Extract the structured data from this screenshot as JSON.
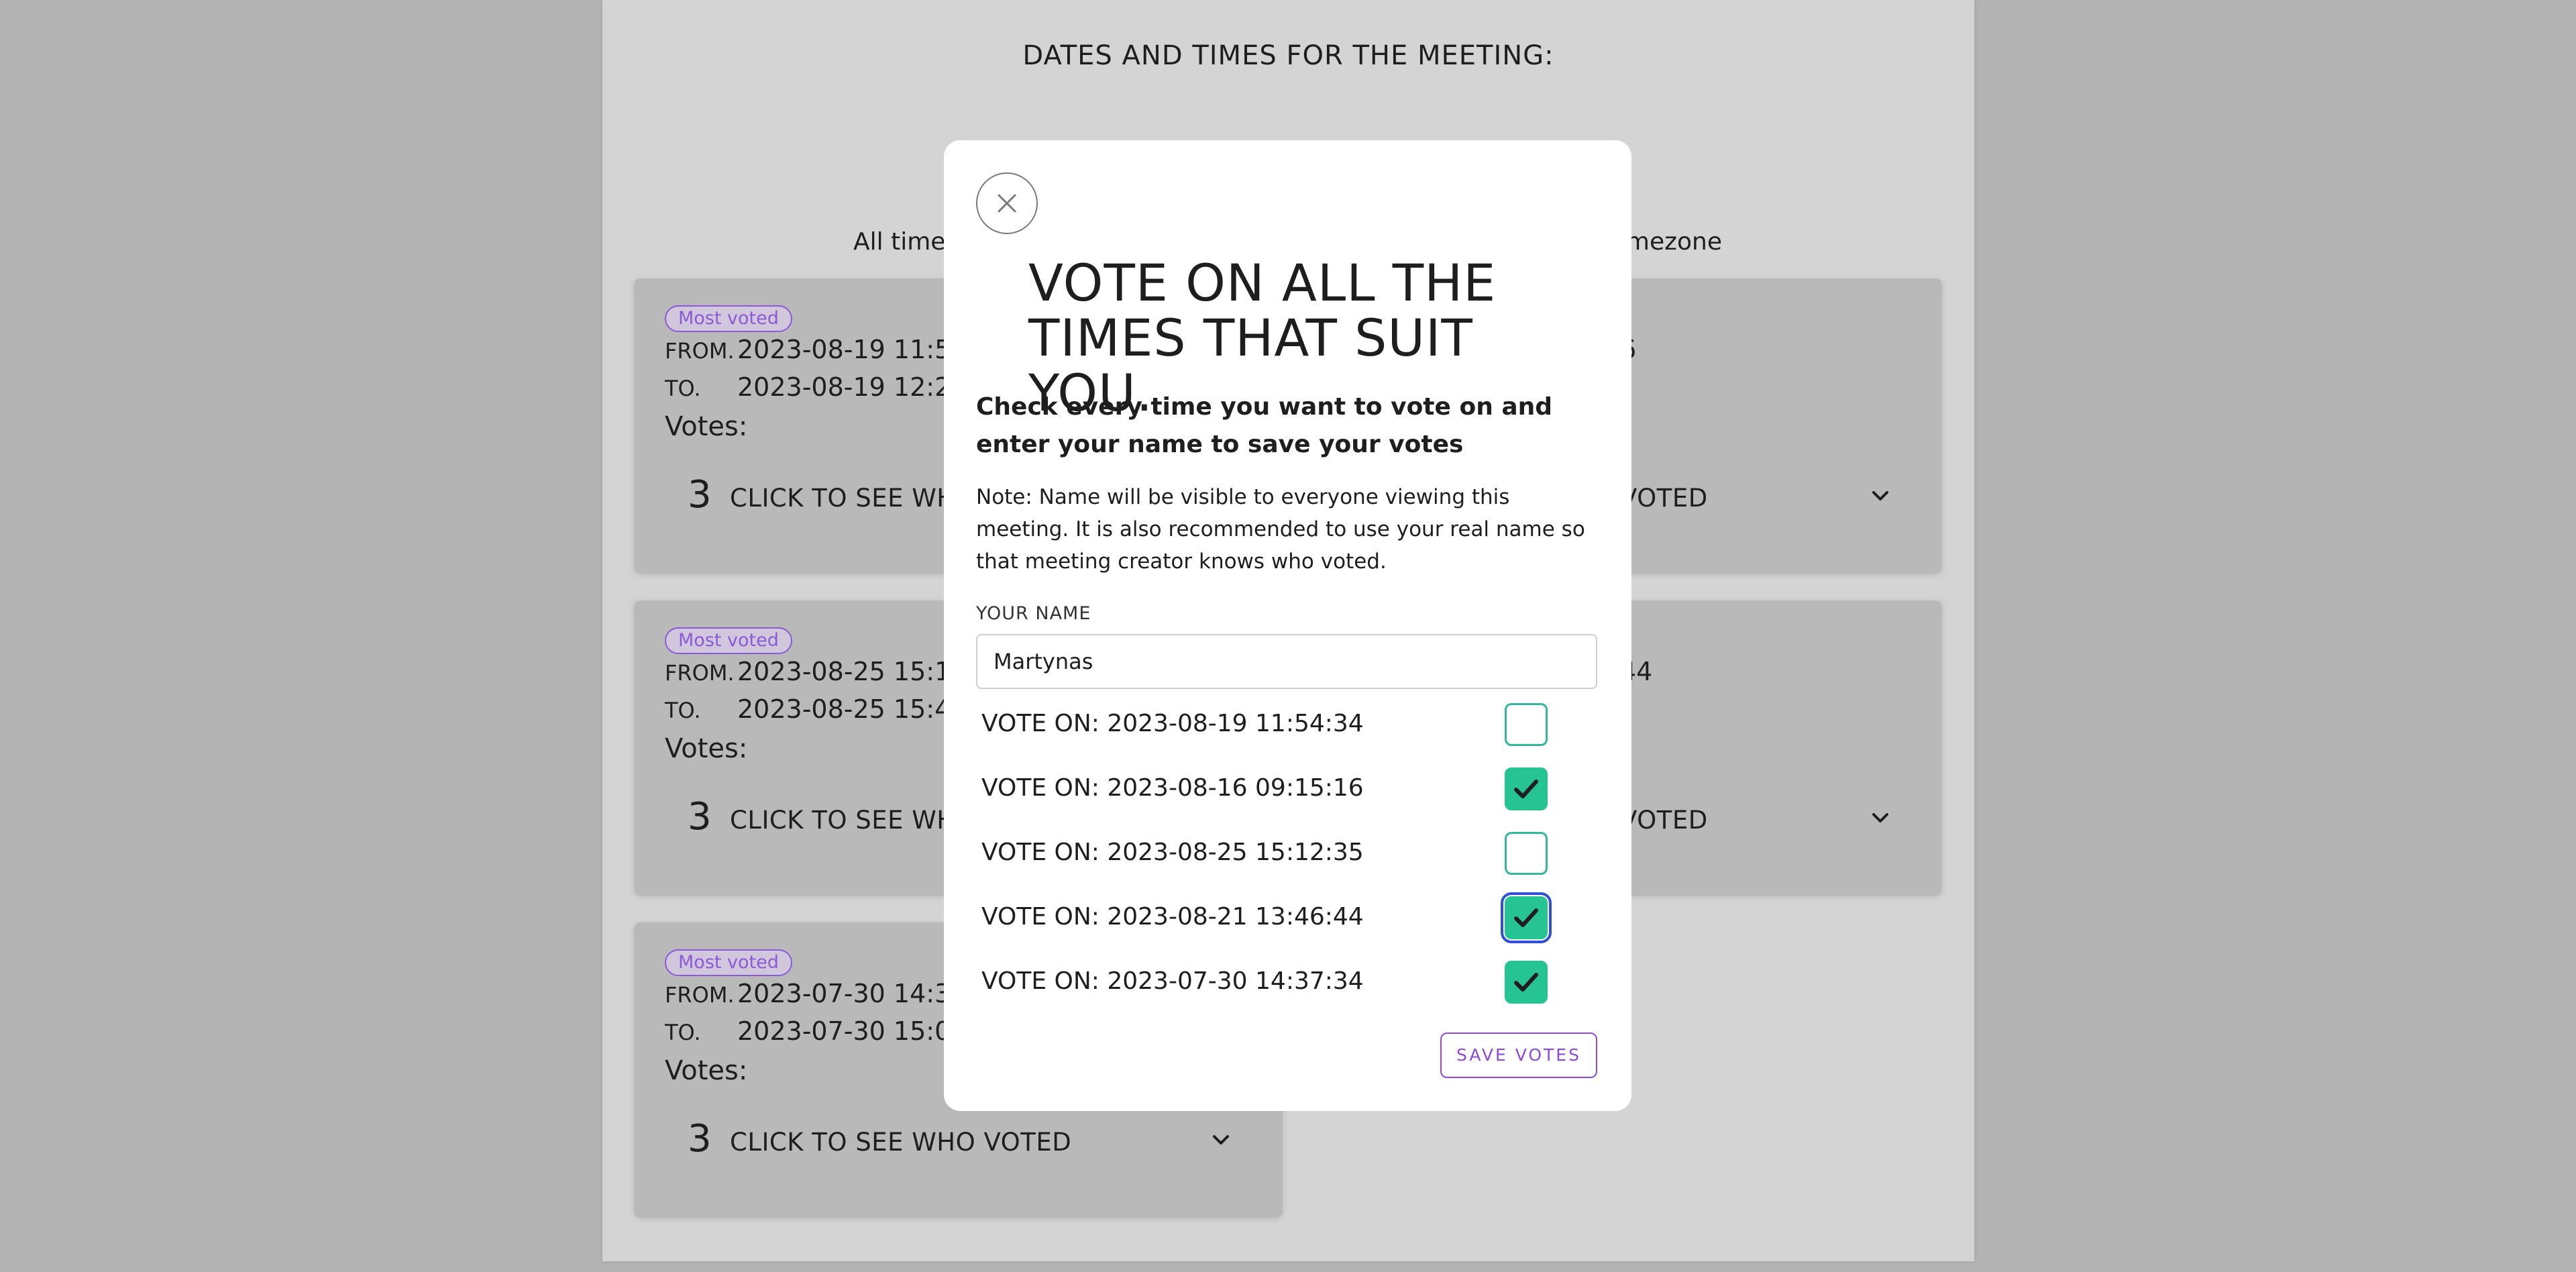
{
  "page": {
    "heading": "DATES AND TIMES FOR THE MEETING:",
    "timezone_left": "All times",
    "timezone_right": "imezone"
  },
  "cards": [
    {
      "badge": "Most voted",
      "from_label": "FROM.",
      "from": "2023-08-19 11:54",
      "to_label": "TO.",
      "to": "2023-08-19 12:24",
      "votes_label": "Votes:",
      "count": "3",
      "see_who": "CLICK TO SEE WHO"
    },
    {
      "badge": "Most voted",
      "from_label": "FROM.",
      "from": "2023-08-25 15:12",
      "to_label": "TO.",
      "to": "2023-08-25 15:4",
      "votes_label": "Votes:",
      "count": "3",
      "see_who": "CLICK TO SEE WHO"
    },
    {
      "badge": "Most voted",
      "from_label": "FROM.",
      "from": "2023-07-30 14:37",
      "to_label": "TO.",
      "to": "2023-07-30 15:0",
      "votes_label": "Votes:",
      "count": "3",
      "see_who": "CLICK TO SEE WHO VOTED"
    }
  ],
  "right_cards": [
    {
      "from_tail": "6",
      "see_who_tail": "VOTED"
    },
    {
      "from_tail": "44",
      "see_who_tail": "VOTED"
    }
  ],
  "modal": {
    "title": "VOTE ON ALL THE TIMES THAT SUIT YOU.",
    "subtitle": "Check every time you want to vote on and enter your name to save your votes",
    "note": "Note: Name will be visible to everyone viewing this meeting. It is also recommended to use your real name so that meeting creator knows who voted.",
    "name_label": "YOUR NAME",
    "name_value": "Martynas",
    "votes": [
      {
        "label": "VOTE ON: 2023-08-19 11:54:34",
        "checked": false
      },
      {
        "label": "VOTE ON: 2023-08-16 09:15:16",
        "checked": true
      },
      {
        "label": "VOTE ON: 2023-08-25 15:12:35",
        "checked": false
      },
      {
        "label": "VOTE ON: 2023-08-21 13:46:44",
        "checked": true,
        "focused": true
      },
      {
        "label": "VOTE ON: 2023-07-30 14:37:34",
        "checked": true
      }
    ],
    "save_label": "SAVE VOTES"
  },
  "colors": {
    "accent_purple": "#8c4bde",
    "checkbox_green": "#26c492",
    "focus_blue": "#2f4fd6"
  },
  "icons": {
    "close": "close-icon",
    "checkmark": "check-icon",
    "expand": "chevron-down-icon"
  }
}
